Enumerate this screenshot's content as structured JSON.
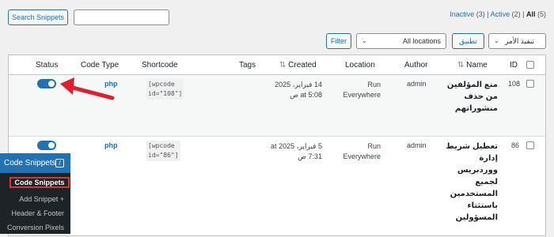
{
  "toolbar": {
    "search_button": "Search Snippets",
    "search_value": "",
    "filter_button": "Filter",
    "locations_select": "All locations",
    "apply_button": "تطبيق",
    "bulk_select": "تنفيذ الأمر"
  },
  "views": {
    "inactive_label": "Inactive",
    "inactive_count": "(3)",
    "active_label": "Active",
    "active_count": "(2)",
    "all_label": "All",
    "all_count": "(5)"
  },
  "table": {
    "headers": {
      "status": "Status",
      "code_type": "Code Type",
      "shortcode": "Shortcode",
      "tags": "Tags",
      "created": "Created",
      "location": "Location",
      "author": "Author",
      "name": "Name",
      "id": "ID"
    },
    "rows": [
      {
        "status": "active",
        "code_type": "php",
        "shortcode_l1": "[wpcode",
        "shortcode_l2": "id=\"108\"]",
        "created_l1": "14 فبراير، 2025",
        "created_l2": "at 5:08 ص",
        "location_l1": "Run",
        "location_l2": "Everywhere",
        "author": "admin",
        "name_lines": [
          "منع المؤلفين",
          "من حذف",
          "منشوراتهم"
        ],
        "id": "108"
      },
      {
        "status": "active",
        "code_type": "php",
        "shortcode_l1": "[wpcode",
        "shortcode_l2": "id=\"86\"]",
        "created_l1": "5 فبراير، 2025 at",
        "created_l2": "7:31 ص",
        "location_l1": "Run",
        "location_l2": "Everywhere",
        "author": "admin",
        "name_lines": [
          "تعطيل شريط",
          "إدارة",
          "ووردبريس",
          "لجميع",
          "المستخدمين",
          "باستثناء",
          "المسؤولين"
        ],
        "id": "86"
      }
    ]
  },
  "sidebar": {
    "top_label": "Code Snippets",
    "top_icon": "code-icon",
    "items": [
      {
        "label": "Code Snippets"
      },
      {
        "label": "Add Snippet +"
      },
      {
        "label": "Header & Footer"
      },
      {
        "label": "Conversion Pixels"
      }
    ]
  },
  "colors": {
    "accent": "#2271b1",
    "arrow": "#e11d2e",
    "highlight_box": "#d63638"
  }
}
